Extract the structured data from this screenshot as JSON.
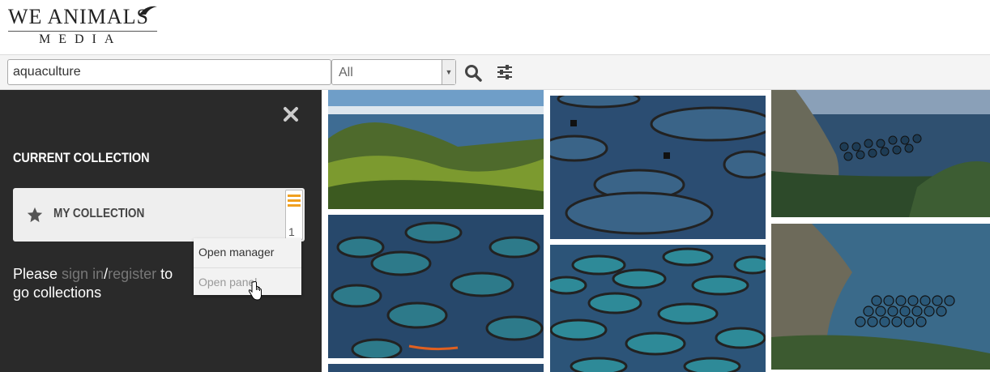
{
  "brand": {
    "logo_top": "WE ANIMALS",
    "logo_bottom": "MEDIA"
  },
  "search": {
    "value": "aquaculture",
    "filter_selected": "All"
  },
  "icons": {
    "search": "search-icon",
    "filters": "sliders-icon",
    "close": "close-icon",
    "star": "star-icon",
    "menu": "hamburger-icon"
  },
  "panel": {
    "title": "CURRENT COLLECTION",
    "collection_name": "MY COLLECTION",
    "collection_count": "1",
    "menu_items": [
      "Open manager",
      "Open panel"
    ],
    "signin": {
      "prefix": "Please ",
      "sign_in": "sign in",
      "slash": "/",
      "register": "register",
      "suffix": " to go collections"
    }
  },
  "colors": {
    "panel_bg": "#2a2a2a",
    "accent": "#f0a020"
  }
}
